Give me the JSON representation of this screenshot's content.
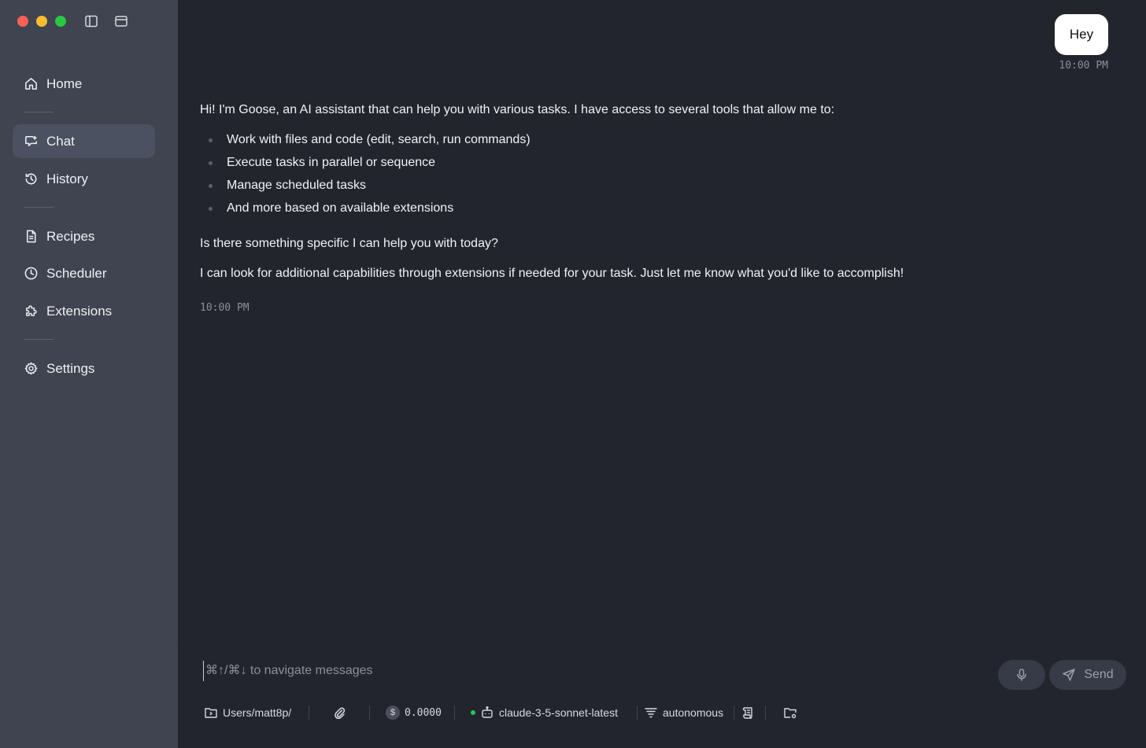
{
  "sidebar": {
    "items": [
      {
        "label": "Home",
        "icon": "home-icon"
      },
      {
        "label": "Chat",
        "icon": "chat-icon",
        "active": true
      },
      {
        "label": "History",
        "icon": "history-icon"
      },
      {
        "label": "Recipes",
        "icon": "recipes-icon"
      },
      {
        "label": "Scheduler",
        "icon": "clock-icon"
      },
      {
        "label": "Extensions",
        "icon": "puzzle-icon"
      },
      {
        "label": "Settings",
        "icon": "gear-icon"
      }
    ]
  },
  "chat": {
    "user_message": {
      "text": "Hey",
      "time": "10:00 PM"
    },
    "assistant_message": {
      "intro": "Hi! I'm Goose, an AI assistant that can help you with various tasks. I have access to several tools that allow me to:",
      "bullets": [
        "Work with files and code (edit, search, run commands)",
        "Execute tasks in parallel or sequence",
        "Manage scheduled tasks",
        "And more based on available extensions"
      ],
      "question": "Is there something specific I can help you with today?",
      "closing": "I can look for additional capabilities through extensions if needed for your task. Just let me know what you'd like to accomplish!",
      "time": "10:00 PM"
    }
  },
  "composer": {
    "placeholder": "⌘↑/⌘↓ to navigate messages",
    "value": "",
    "send_label": "Send"
  },
  "status_bar": {
    "directory": "Users/matt8p/",
    "cost": "0.0000",
    "model": "claude-3-5-sonnet-latest",
    "mode": "autonomous"
  },
  "colors": {
    "sidebar_bg": "#3f4450",
    "main_bg": "#22252c",
    "active_item_bg": "#4b5160",
    "user_bubble_bg": "#ffffff",
    "status_dot": "#22c55e"
  }
}
